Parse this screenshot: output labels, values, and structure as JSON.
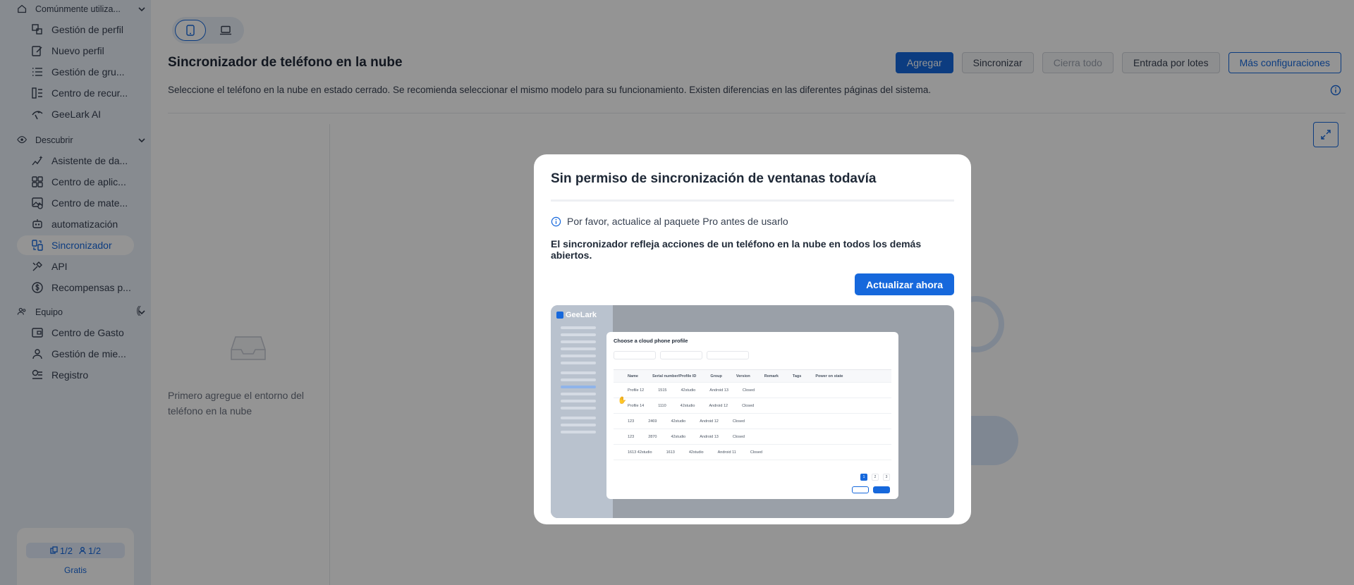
{
  "sidebar": {
    "sections": [
      {
        "title": "Comúnmente utiliza...",
        "icon": "home-icon",
        "items": [
          {
            "label": "Gestión de perfil",
            "icon": "profile-management-icon"
          },
          {
            "label": "Nuevo perfil",
            "icon": "edit-icon"
          },
          {
            "label": "Gestión de gru...",
            "icon": "list-icon"
          },
          {
            "label": "Centro de recur...",
            "icon": "resource-center-icon"
          },
          {
            "label": "GeeLark AI",
            "icon": "ai-icon"
          }
        ]
      },
      {
        "title": "Descubrir",
        "icon": "eye-icon",
        "items": [
          {
            "label": "Asistente de da...",
            "icon": "chart-sparkle-icon"
          },
          {
            "label": "Centro de aplic...",
            "icon": "apps-grid-icon"
          },
          {
            "label": "Centro de mate...",
            "icon": "image-material-icon"
          },
          {
            "label": "automatización",
            "icon": "robot-icon"
          },
          {
            "label": "Sincronizador",
            "icon": "sync-icon",
            "active": true
          },
          {
            "label": "API",
            "icon": "api-tools-icon"
          },
          {
            "label": "Recompensas p...",
            "icon": "dollar-icon"
          }
        ]
      },
      {
        "title": "Equipo",
        "icon": "team-icon",
        "items": [
          {
            "label": "Centro de Gasto",
            "icon": "wallet-icon"
          },
          {
            "label": "Gestión de mie...",
            "icon": "user-icon"
          },
          {
            "label": "Registro",
            "icon": "log-icon"
          }
        ]
      }
    ],
    "plan": {
      "profiles": "1/2",
      "members": "1/2",
      "name": "Gratis"
    }
  },
  "main": {
    "title": "Sincronizador de teléfono en la nube",
    "hint": "Seleccione el teléfono en la nube en estado cerrado. Se recomienda seleccionar el mismo modelo para su funcionamiento. Existen diferencias en las diferentes páginas del sistema.",
    "toolbar": {
      "add": "Agregar",
      "sync": "Sincronizar",
      "close_all": "Cierra todo",
      "batch_input": "Entrada por lotes",
      "more_settings": "Más configuraciones"
    },
    "empty_text": "Primero agregue el entorno del teléfono en la nube"
  },
  "modal": {
    "title": "Sin permiso de sincronización de ventanas todavía",
    "notice": "Por favor, actualice al paquete Pro antes de usarlo",
    "description": "El sincronizador refleja acciones de un teléfono en la nube en todos los demás abiertos.",
    "upgrade_button": "Actualizar ahora",
    "preview": {
      "logo": "GeeLark",
      "dialog_title": "Choose a cloud phone profile",
      "columns": [
        "Name",
        "Serial number/Profile ID",
        "Group",
        "Version",
        "Remark",
        "Tags",
        "Power on state"
      ],
      "rows": [
        [
          "Profile 12",
          "1515",
          "42studio",
          "Android 13",
          "Closed"
        ],
        [
          "Profile 14",
          "1110",
          "42studio",
          "Android 12",
          "Closed"
        ],
        [
          "123",
          "2469",
          "42studio",
          "Android 12",
          "Closed"
        ],
        [
          "123",
          "2870",
          "42studio",
          "Android 13",
          "Closed"
        ],
        [
          "1613 42studio",
          "1613",
          "42studio",
          "Android 11",
          "Closed"
        ]
      ],
      "pages": [
        "1",
        "2",
        "3"
      ]
    }
  },
  "colors": {
    "accent": "#1668dc",
    "sidebar_bg": "#e8eff9"
  }
}
